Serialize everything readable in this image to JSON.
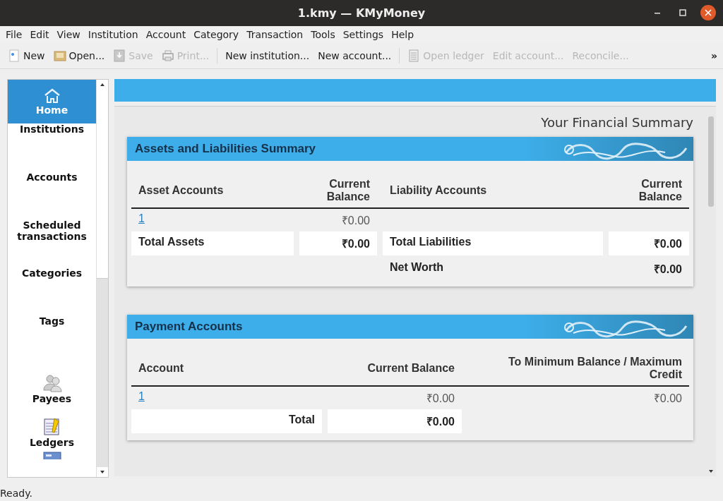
{
  "window": {
    "title": "1.kmy — KMyMoney"
  },
  "menu": [
    "File",
    "Edit",
    "View",
    "Institution",
    "Account",
    "Category",
    "Transaction",
    "Tools",
    "Settings",
    "Help"
  ],
  "toolbar": [
    {
      "label": "New",
      "disabled": false
    },
    {
      "label": "Open...",
      "disabled": false
    },
    {
      "label": "Save",
      "disabled": true
    },
    {
      "label": "Print...",
      "disabled": true
    },
    {
      "label": "New institution...",
      "disabled": false
    },
    {
      "label": "New account...",
      "disabled": false
    },
    {
      "label": "Open ledger",
      "disabled": true
    },
    {
      "label": "Edit account...",
      "disabled": true
    },
    {
      "label": "Reconcile...",
      "disabled": true
    }
  ],
  "toolbar_overflow": "»",
  "sidebar": {
    "items": [
      {
        "label": "Home",
        "selected": true
      },
      {
        "label": "Institutions",
        "selected": false
      },
      {
        "label": "Accounts",
        "selected": false
      },
      {
        "label": "Scheduled transactions",
        "selected": false
      },
      {
        "label": "Categories",
        "selected": false
      },
      {
        "label": "Tags",
        "selected": false
      },
      {
        "label": "Payees",
        "selected": false
      },
      {
        "label": "Ledgers",
        "selected": false
      }
    ]
  },
  "summary_title": "Your Financial Summary",
  "assets_liabilities": {
    "title": "Assets and Liabilities Summary",
    "columns": [
      "Asset Accounts",
      "Current Balance",
      "Liability Accounts",
      "Current Balance"
    ],
    "rows": [
      [
        "1",
        "₹0.00",
        "",
        ""
      ]
    ],
    "totals": [
      {
        "label": "Total Assets",
        "value": "₹0.00"
      },
      {
        "label": "Total Liabilities",
        "value": "₹0.00"
      }
    ],
    "net_worth": {
      "label": "Net Worth",
      "value": "₹0.00"
    }
  },
  "payment_accounts": {
    "title": "Payment Accounts",
    "columns": [
      "Account",
      "Current Balance",
      "To Minimum Balance / Maximum Credit"
    ],
    "rows": [
      [
        "1",
        "₹0.00",
        "₹0.00"
      ]
    ],
    "total": {
      "label": "Total",
      "value": "₹0.00"
    }
  },
  "status_bar": "Ready."
}
